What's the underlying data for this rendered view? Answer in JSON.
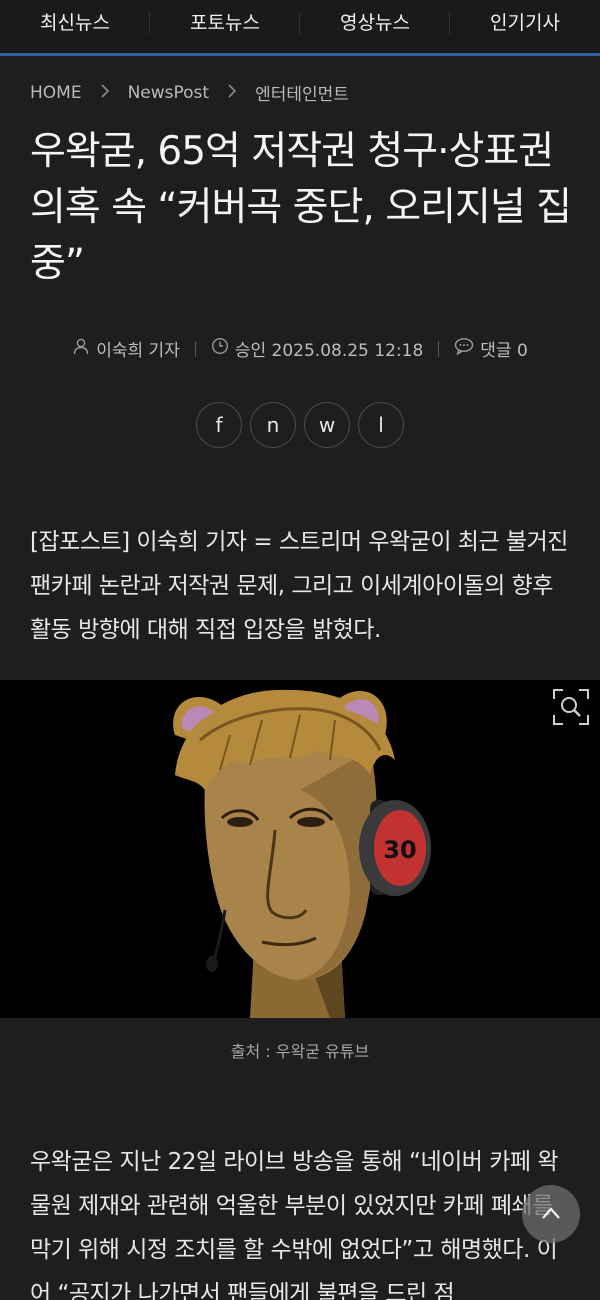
{
  "nav": {
    "items": [
      {
        "label": "최신뉴스"
      },
      {
        "label": "포토뉴스"
      },
      {
        "label": "영상뉴스"
      },
      {
        "label": "인기기사"
      }
    ]
  },
  "breadcrumb": {
    "home": "HOME",
    "section": "NewsPost",
    "category": "엔터테인먼트"
  },
  "article": {
    "title": "우왁굳, 65억 저작권 청구·상표권 의혹 속 “커버곡 중단, 오리지널 집중”",
    "author": "이숙희 기자",
    "approved": "승인 2025.08.25 12:18",
    "comments": "댓글 0",
    "lead": "[잡포스트] 이숙희 기자 = 스트리머 우왁굳이 최근 불거진 팬카페 논란과 저작권 문제, 그리고 이세계아이돌의 향후 활동 방향에 대해 직접 입장을 밝혔다.",
    "caption": "출처 : 우왁굳 유튜브",
    "body": "우왁굳은 지난 22일 라이브 방송을 통해 “네이버 카페 왁물원 제재와 관련해 억울한 부분이 있었지만 카페 폐쇄를 막기 위해 시정 조치를 할 수밖에 없었다”고 해명했다. 이어 “공지가 나가면서 팬들에게 불편을 드린 점"
  },
  "share": {
    "buttons": [
      {
        "label": "f"
      },
      {
        "label": "n"
      },
      {
        "label": "w"
      },
      {
        "label": "l"
      }
    ]
  },
  "figure": {
    "headphone_text": "30"
  },
  "colors": {
    "background": "#1e1e1f",
    "nav_underline": "#2f5fa6"
  },
  "icons": {
    "author": "person-icon",
    "time": "clock-icon",
    "comments": "comment-icon",
    "zoom": "zoom-icon",
    "top": "chevron-up-icon",
    "breadcrumb_sep": "chevron-right-icon"
  }
}
